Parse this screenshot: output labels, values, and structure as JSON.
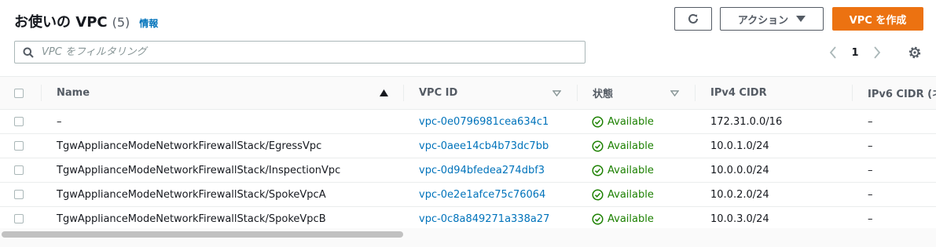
{
  "header": {
    "title": "お使いの VPC",
    "count": "(5)",
    "info": "情報"
  },
  "toolbar": {
    "actions_label": "アクション",
    "create_label": "VPC を作成"
  },
  "search": {
    "placeholder": "VPC をフィルタリング"
  },
  "pagination": {
    "page": "1"
  },
  "table": {
    "columns": [
      "Name",
      "VPC ID",
      "状態",
      "IPv4 CIDR",
      "IPv6 CIDR (ネ"
    ],
    "rows": [
      {
        "name": "–",
        "vpc_id": "vpc-0e0796981cea634c1",
        "state": "Available",
        "ipv4": "172.31.0.0/16",
        "ipv6": "–"
      },
      {
        "name": "TgwApplianceModeNetworkFirewallStack/EgressVpc",
        "vpc_id": "vpc-0aee14cb4b73dc7bb",
        "state": "Available",
        "ipv4": "10.0.1.0/24",
        "ipv6": "–"
      },
      {
        "name": "TgwApplianceModeNetworkFirewallStack/InspectionVpc",
        "vpc_id": "vpc-0d94bfedea274dbf3",
        "state": "Available",
        "ipv4": "10.0.0.0/24",
        "ipv6": "–"
      },
      {
        "name": "TgwApplianceModeNetworkFirewallStack/SpokeVpcA",
        "vpc_id": "vpc-0e2e1afce75c76064",
        "state": "Available",
        "ipv4": "10.0.2.0/24",
        "ipv6": "–"
      },
      {
        "name": "TgwApplianceModeNetworkFirewallStack/SpokeVpcB",
        "vpc_id": "vpc-0c8a849271a338a27",
        "state": "Available",
        "ipv4": "10.0.3.0/24",
        "ipv6": "–"
      }
    ]
  },
  "colors": {
    "accent": "#ec7211",
    "link": "#0073bb",
    "success": "#1d8102"
  }
}
